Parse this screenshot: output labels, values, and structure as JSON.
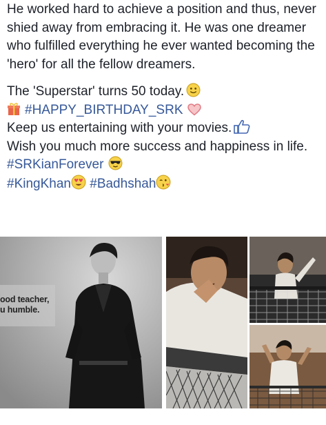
{
  "post": {
    "paragraph1": "He worked hard to achieve a position and thus, never shied away from embracing it. He was one dreamer who fulfilled everything he ever wanted becoming the 'hero' for all the fellow dreamers.",
    "line_superstar": "The 'Superstar' turns 50 today.",
    "hashtag_birthday": "#HAPPY_BIRTHDAY_SRK",
    "line_entertaining": "Keep us entertaining with your movies.",
    "line_wish": "Wish you much more success and happiness in life.",
    "hashtag_forever": "#SRKianForever",
    "hashtag_kingkhan": "#KingKhan",
    "hashtag_badhshah": "#Badhshah"
  },
  "photo_left_quote": {
    "line1": "ood teacher,",
    "line2": "u humble."
  },
  "icons": {
    "smile": "smiley-face-icon",
    "gift": "gift-icon",
    "heart": "heart-icon",
    "like": "thumbs-up-icon",
    "sunglasses": "sunglasses-face-icon",
    "heart_eyes": "heart-eyes-face-icon",
    "kiss": "blowing-kiss-face-icon"
  },
  "colors": {
    "text": "#1d2129",
    "hashtag": "#365899"
  }
}
